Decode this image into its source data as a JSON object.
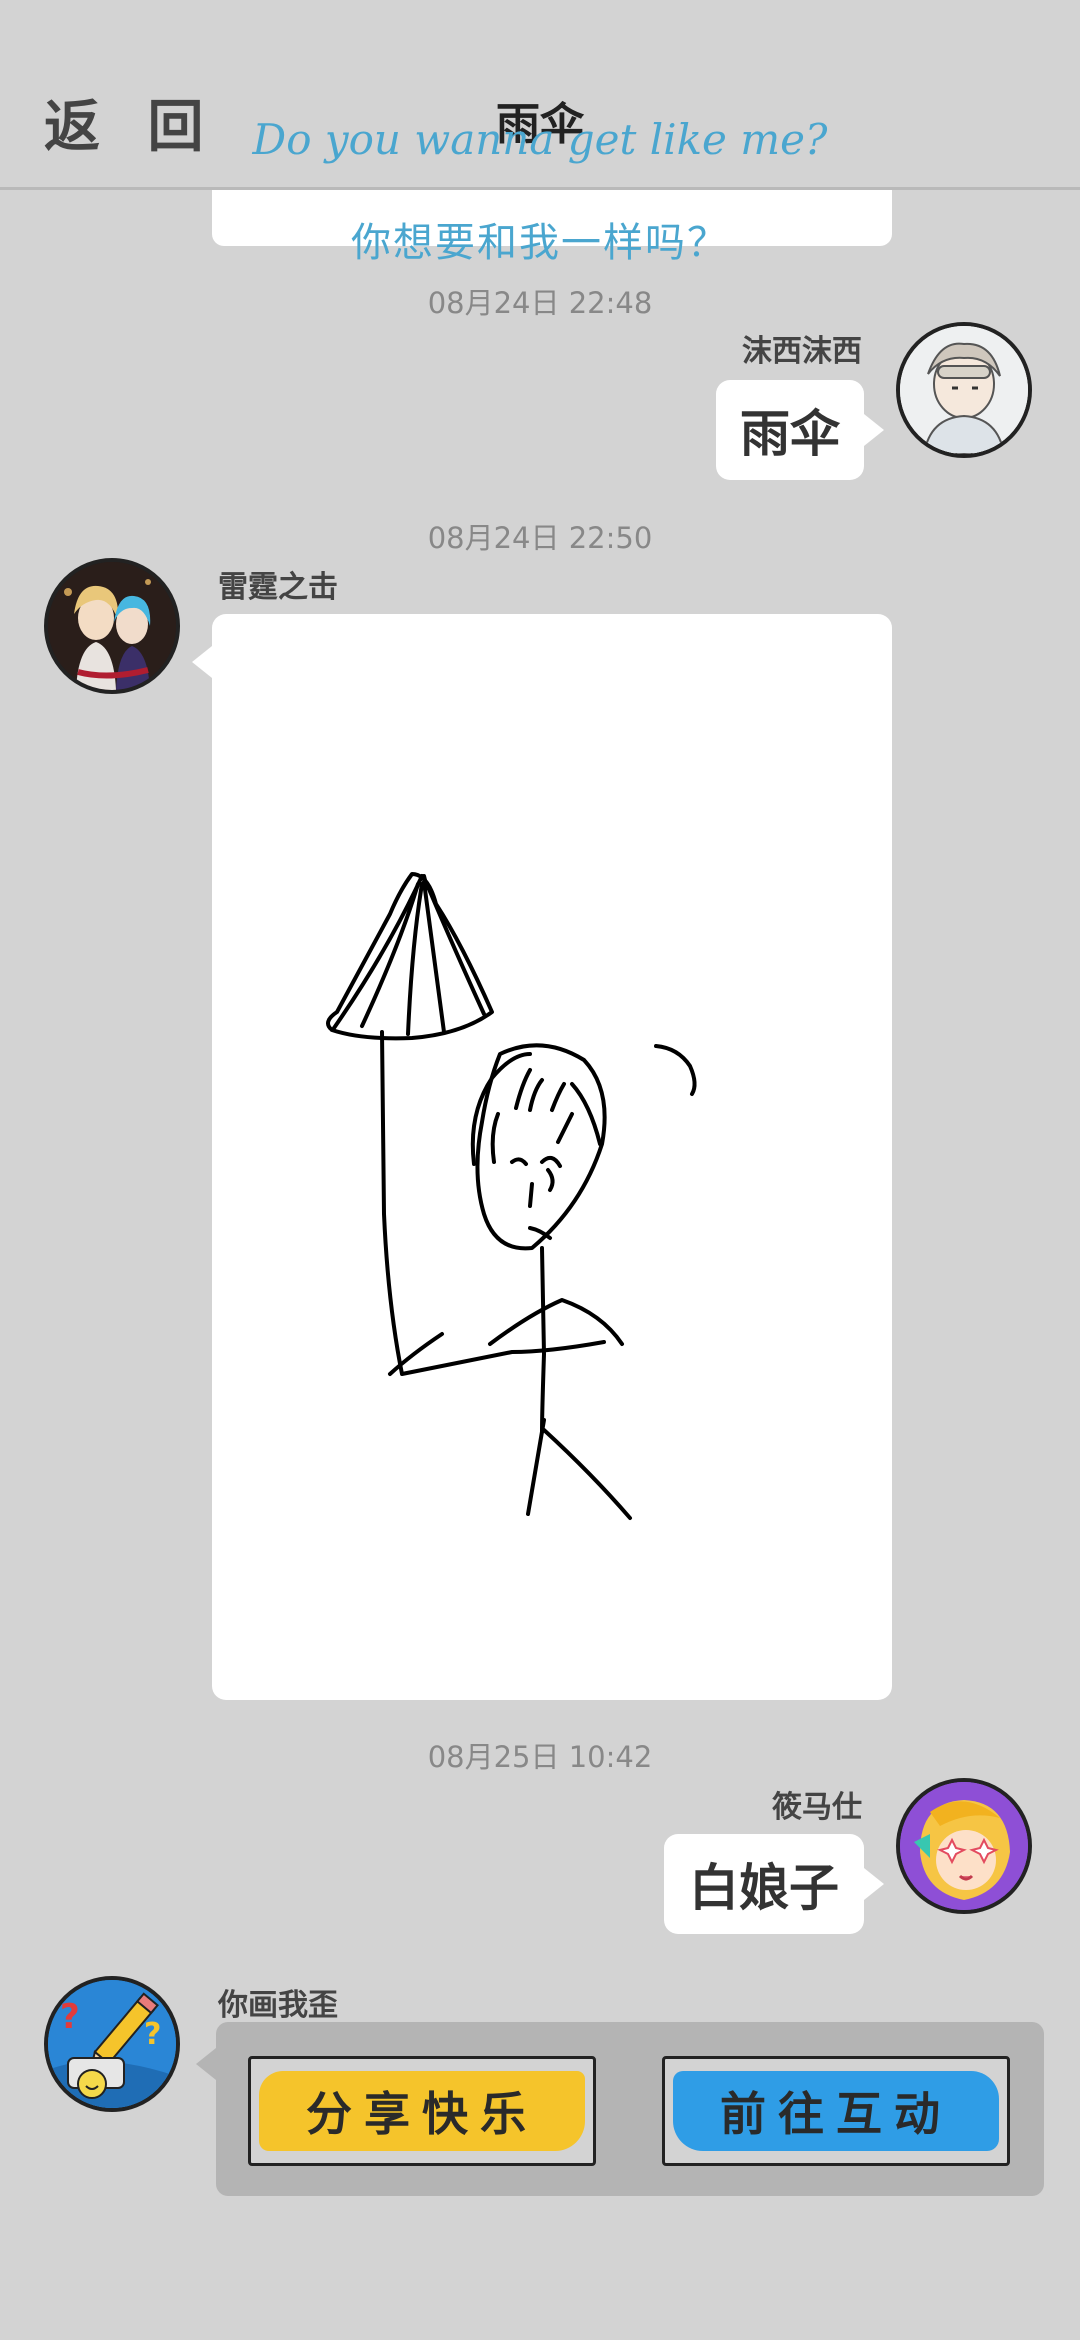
{
  "header": {
    "back_label": "返 回",
    "title": "雨伞",
    "subtitle_en": "Do you wanna get like me?",
    "subtitle_cn": "你想要和我一样吗？"
  },
  "messages": [
    {
      "time": "08月24日  22:48",
      "sender": "沫西沫西",
      "text": "雨伞",
      "side": "right"
    },
    {
      "time": "08月24日  22:50",
      "sender": "雷霆之击",
      "type": "drawing",
      "side": "left"
    },
    {
      "time": "08月25日  10:42",
      "sender": "筱马仕",
      "text": "白娘子",
      "side": "right"
    },
    {
      "sender": "你画我歪",
      "type": "game-card",
      "side": "left"
    }
  ],
  "game_card": {
    "share_label": "分享快乐",
    "go_label": "前往互动"
  },
  "colors": {
    "background": "#d3d3d3",
    "accent_text": "#4aa6cf",
    "share_button": "#f5c42b",
    "go_button": "#2f9de6"
  },
  "icons": [
    "back",
    "user-avatar",
    "pencil-icon"
  ]
}
